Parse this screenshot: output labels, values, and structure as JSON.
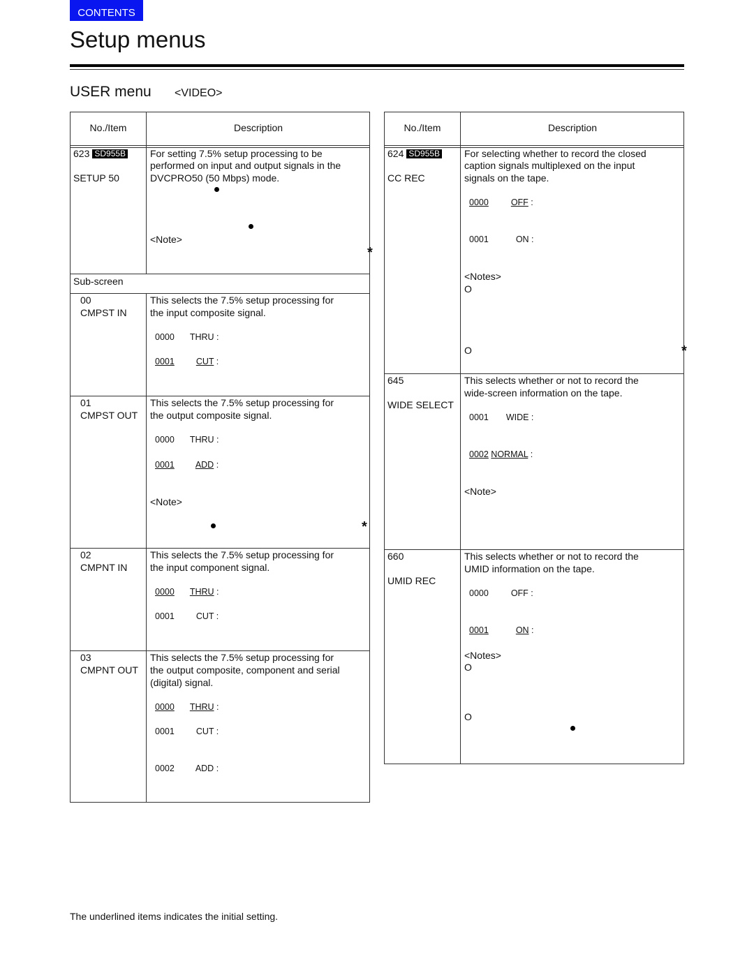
{
  "nav": {
    "contents_label": "CONTENTS",
    "contents_color": "#0a16f0"
  },
  "page": {
    "title": "Setup menus"
  },
  "section": {
    "title": "USER menu",
    "subtitle": "<VIDEO>"
  },
  "left_table": {
    "headers": {
      "item": "No./Item",
      "description": "Description"
    },
    "main": {
      "number": "623",
      "badge": "SD955B",
      "name": "SETUP 50",
      "description": [
        "For setting 7.5% setup processing to be",
        "performed on input and output signals in the",
        "DVCPRO50 (50 Mbps) mode."
      ],
      "note_label": "<Note>"
    },
    "subscreen_label": "Sub-screen",
    "rows": [
      {
        "number": "00",
        "name": "CMPST IN",
        "description": [
          "This selects the 7.5% setup processing for",
          "the input composite signal."
        ],
        "options": [
          {
            "code": "0000",
            "label": "THRU",
            "initial": false
          },
          {
            "code": "0001",
            "label": "CUT",
            "initial": true
          }
        ]
      },
      {
        "number": "01",
        "name": "CMPST OUT",
        "description": [
          "This selects the 7.5% setup processing for",
          "the output composite signal."
        ],
        "options": [
          {
            "code": "0000",
            "label": "THRU",
            "initial": false
          },
          {
            "code": "0001",
            "label": "ADD",
            "initial": true
          }
        ],
        "note_label": "<Note>"
      },
      {
        "number": "02",
        "name": "CMPNT IN",
        "description": [
          "This selects the 7.5% setup processing for",
          "the input component signal."
        ],
        "options": [
          {
            "code": "0000",
            "label": "THRU",
            "initial": true
          },
          {
            "code": "0001",
            "label": "CUT",
            "initial": false
          }
        ]
      },
      {
        "number": "03",
        "name": "CMPNT OUT",
        "description": [
          "This selects the 7.5% setup processing for",
          "the output composite, component and serial",
          "(digital) signal."
        ],
        "options": [
          {
            "code": "0000",
            "label": "THRU",
            "initial": true
          },
          {
            "code": "0001",
            "label": "CUT",
            "initial": false
          },
          {
            "code": "0002",
            "label": "ADD",
            "initial": false
          }
        ]
      }
    ]
  },
  "right_table": {
    "headers": {
      "item": "No./Item",
      "description": "Description"
    },
    "rows": [
      {
        "number": "624",
        "badge": "SD955B",
        "name": "CC REC",
        "description": [
          "For selecting whether to record the closed",
          "caption signals multiplexed on the input",
          "signals on the tape."
        ],
        "options": [
          {
            "code": "0000",
            "label": "OFF",
            "initial": true
          },
          {
            "code": "0001",
            "label": "ON",
            "initial": false
          }
        ],
        "note_label": "<Notes>",
        "bullets": [
          "O",
          "O"
        ]
      },
      {
        "number": "645",
        "name": "WIDE SELECT",
        "description": [
          "This selects whether or not to record the",
          "wide-screen information on the tape."
        ],
        "options": [
          {
            "code": "0001",
            "label": "WIDE",
            "initial": false
          },
          {
            "code": "0002",
            "label": "NORMAL",
            "initial": true
          }
        ],
        "note_label": "<Note>"
      },
      {
        "number": "660",
        "name": "UMID REC",
        "description": [
          "This selects whether or not to record the",
          "UMID information on the tape."
        ],
        "options": [
          {
            "code": "0000",
            "label": "OFF",
            "initial": false
          },
          {
            "code": "0001",
            "label": "ON",
            "initial": true
          }
        ],
        "note_label": "<Notes>",
        "bullets": [
          "O",
          "O"
        ]
      }
    ]
  },
  "marks": {
    "asterisk": "*"
  },
  "footer": {
    "note": "The underlined items indicates the initial setting."
  }
}
